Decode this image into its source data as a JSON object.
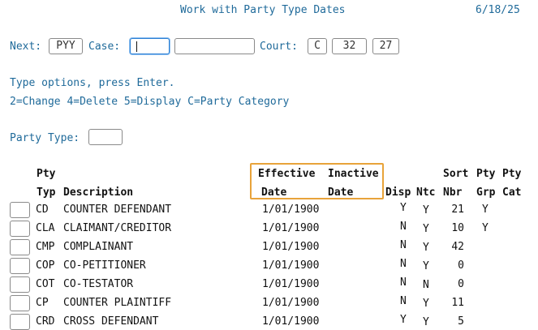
{
  "header": {
    "title": "Work with Party Type Dates",
    "date": "6/18/25"
  },
  "nav": {
    "next_label": "Next:",
    "next_value": "PYY",
    "case_label": "Case:",
    "case_value1": "",
    "case_value2": "",
    "court_label": "Court:",
    "court_v1": "C",
    "court_v2": "32",
    "court_v3": "27"
  },
  "instructions": {
    "line1": "Type options, press Enter.",
    "line2": "2=Change  4=Delete  5=Display  C=Party Category"
  },
  "filter": {
    "party_type_label": "Party Type:",
    "party_type_value": ""
  },
  "columns": {
    "pty": "Pty",
    "typ": "Typ",
    "description": "Description",
    "effective": "Effective",
    "inactive": "Inactive",
    "date1": "Date",
    "date2": "Date",
    "disp": "Disp",
    "ntc": "Ntc",
    "sort": "Sort",
    "nbr": "Nbr",
    "pty2": "Pty",
    "grp": "Grp",
    "pty3": "Pty",
    "cat": "Cat"
  },
  "rows": [
    {
      "typ": "CD",
      "desc": "COUNTER DEFENDANT",
      "eff": "1/01/1900",
      "disp": "Y",
      "ntc": "Y",
      "sort": "21",
      "grp": "Y",
      "cat": ""
    },
    {
      "typ": "CLA",
      "desc": "CLAIMANT/CREDITOR",
      "eff": "1/01/1900",
      "disp": "N",
      "ntc": "Y",
      "sort": "10",
      "grp": "Y",
      "cat": ""
    },
    {
      "typ": "CMP",
      "desc": "COMPLAINANT",
      "eff": "1/01/1900",
      "disp": "N",
      "ntc": "Y",
      "sort": "42",
      "grp": "",
      "cat": ""
    },
    {
      "typ": "COP",
      "desc": "CO-PETITIONER",
      "eff": "1/01/1900",
      "disp": "N",
      "ntc": "Y",
      "sort": "0",
      "grp": "",
      "cat": ""
    },
    {
      "typ": "COT",
      "desc": "CO-TESTATOR",
      "eff": "1/01/1900",
      "disp": "N",
      "ntc": "N",
      "sort": "0",
      "grp": "",
      "cat": ""
    },
    {
      "typ": "CP",
      "desc": "COUNTER PLAINTIFF",
      "eff": "1/01/1900",
      "disp": "N",
      "ntc": "Y",
      "sort": "11",
      "grp": "",
      "cat": ""
    },
    {
      "typ": "CRD",
      "desc": "CROSS DEFENDANT",
      "eff": "1/01/1900",
      "disp": "Y",
      "ntc": "Y",
      "sort": "5",
      "grp": "",
      "cat": ""
    }
  ]
}
